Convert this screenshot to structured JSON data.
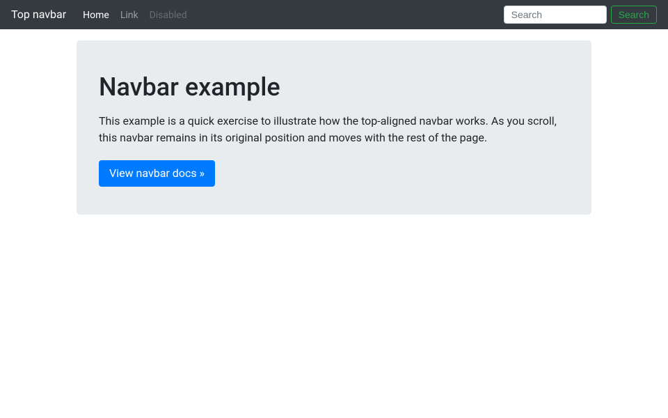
{
  "navbar": {
    "brand": "Top navbar",
    "items": [
      {
        "label": "Home",
        "state": "active"
      },
      {
        "label": "Link",
        "state": "normal"
      },
      {
        "label": "Disabled",
        "state": "disabled"
      }
    ],
    "search": {
      "placeholder": "Search",
      "button_label": "Search"
    }
  },
  "jumbotron": {
    "title": "Navbar example",
    "lead": "This example is a quick exercise to illustrate how the top-aligned navbar works. As you scroll, this navbar remains in its original position and moves with the rest of the page.",
    "cta_label": "View navbar docs »"
  }
}
